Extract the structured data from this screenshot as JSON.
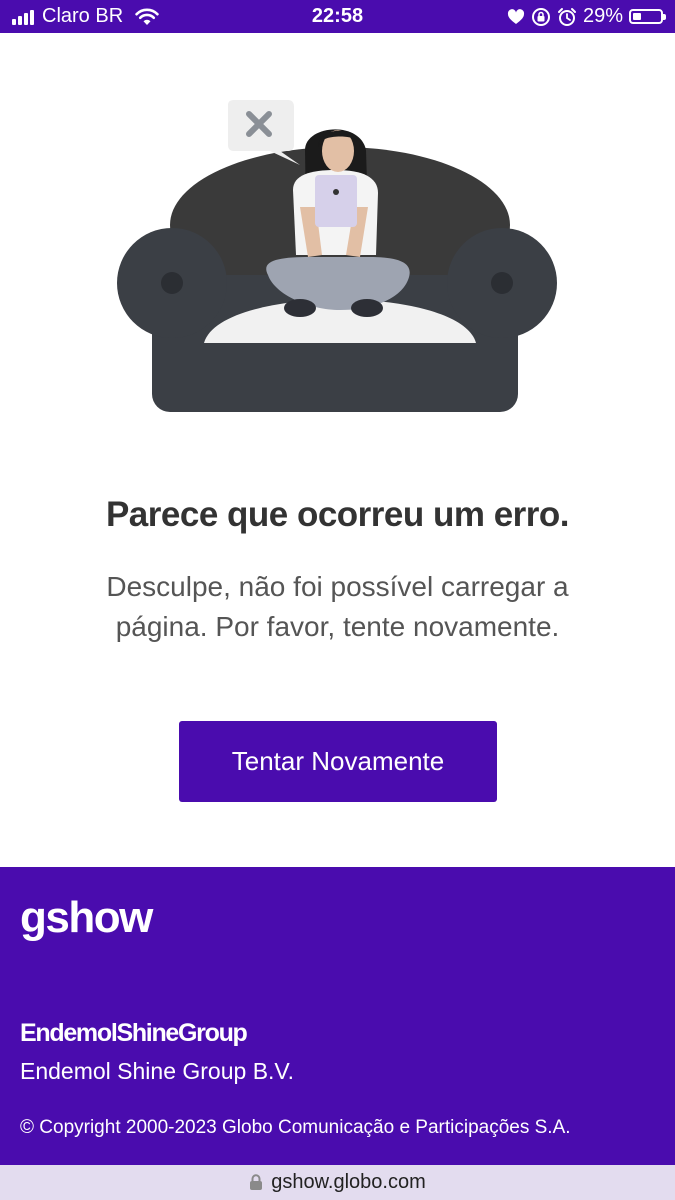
{
  "status_bar": {
    "carrier": "Claro BR",
    "time": "22:58",
    "battery_percent": "29%",
    "battery_level": 0.29,
    "icons": [
      "signal-icon",
      "wifi-icon",
      "heart-icon",
      "screen-lock-icon",
      "alarm-icon",
      "battery-icon"
    ]
  },
  "error": {
    "title": "Parece que ocorreu um erro.",
    "message": "Desculpe, não foi possível carregar a página. Por favor, tente novamente.",
    "retry_label": "Tentar Novamente"
  },
  "footer": {
    "brand": "gshow",
    "partner_logo": "EndemolShineGroup",
    "partner_name": "Endemol Shine Group B.V.",
    "copyright": "© Copyright 2000-2023 Globo Comunicação e Participações S.A."
  },
  "url_bar": {
    "url": "gshow.globo.com"
  },
  "colors": {
    "brand_purple": "#4a0cae",
    "url_bar_bg": "#e3dcef",
    "title_text": "#333333",
    "message_text": "#555555"
  }
}
